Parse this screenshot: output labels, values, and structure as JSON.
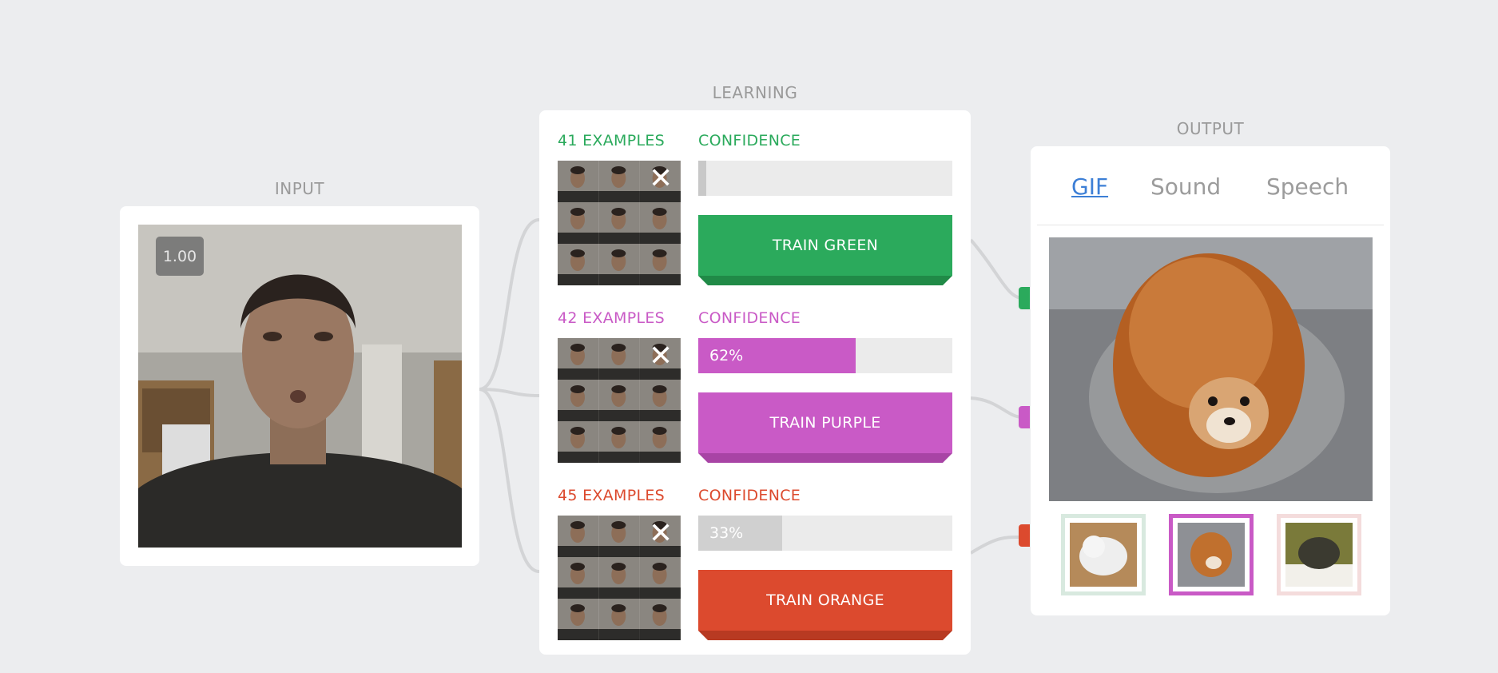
{
  "input": {
    "title": "INPUT",
    "confidence_badge": "1.00"
  },
  "learning": {
    "title": "LEARNING",
    "classes": [
      {
        "examples_label": "41 EXAMPLES",
        "confidence_label": "CONFIDENCE",
        "confidence_text": "",
        "confidence_value": 0.03,
        "train_label": "TRAIN GREEN",
        "color": "#2baa5c",
        "dark": "#208a47",
        "bar_color": "#c8c8c8"
      },
      {
        "examples_label": "42 EXAMPLES",
        "confidence_label": "CONFIDENCE",
        "confidence_text": "62%",
        "confidence_value": 0.62,
        "train_label": "TRAIN PURPLE",
        "color": "#c95ac6",
        "dark": "#a844a5",
        "bar_color": "#c95ac6"
      },
      {
        "examples_label": "45 EXAMPLES",
        "confidence_label": "CONFIDENCE",
        "confidence_text": "33%",
        "confidence_value": 0.33,
        "train_label": "TRAIN ORANGE",
        "color": "#dc4a2e",
        "dark": "#b83a22",
        "bar_color": "#d0d0d0"
      }
    ]
  },
  "output": {
    "title": "OUTPUT",
    "tabs": [
      "GIF",
      "Sound",
      "Speech"
    ],
    "active_tab": "GIF"
  },
  "colors": {
    "green": "#2baa5c",
    "purple": "#c95ac6",
    "orange": "#dc4a2e",
    "link": "#3d7fd6"
  }
}
